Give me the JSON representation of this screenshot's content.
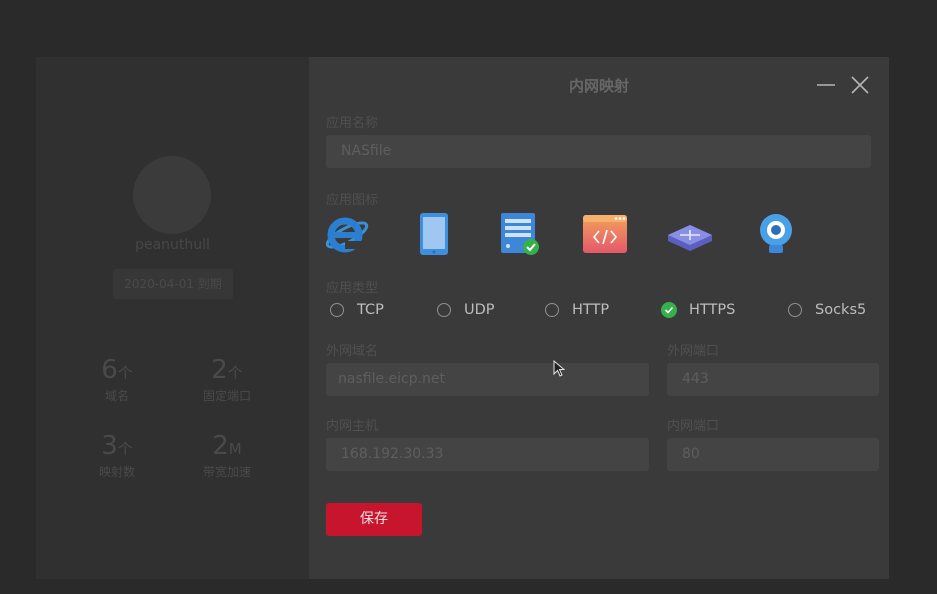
{
  "profile": {
    "username": "peanuthull",
    "expiry": "2020-04-01 到期",
    "stats": [
      {
        "num": "6",
        "unit": "个",
        "label": "域名"
      },
      {
        "num": "2",
        "unit": "个",
        "label": "固定端口"
      },
      {
        "num": "3",
        "unit": "个",
        "label": "映射数"
      },
      {
        "num": "2",
        "unit": "M",
        "label": "带宽加速"
      }
    ]
  },
  "dialog": {
    "title": "内网映射",
    "app_name": {
      "label": "应用名称",
      "value": "NASfile"
    },
    "app_icon": {
      "label": "应用图标",
      "options": [
        "ie-browser-icon",
        "tablet-icon",
        "server-icon",
        "code-window-icon",
        "router-icon",
        "webcam-icon"
      ],
      "selected": "server-icon"
    },
    "app_type": {
      "label": "应用类型",
      "options": [
        "TCP",
        "UDP",
        "HTTP",
        "HTTPS",
        "Socks5"
      ],
      "selected": "HTTPS"
    },
    "external_domain": {
      "label": "外网域名",
      "value": "nasfile.eicp.net"
    },
    "external_port": {
      "label": "外网端口",
      "value": "443"
    },
    "internal_host": {
      "label": "内网主机",
      "value": "168.192.30.33"
    },
    "internal_port": {
      "label": "内网端口",
      "value": "80"
    },
    "save_label": "保存"
  },
  "colors": {
    "accent": "#c8152e",
    "selected_radio": "#35b04a",
    "dialog_bg": "#3a3a3b",
    "overlay_bg": "#2a2a2b"
  }
}
